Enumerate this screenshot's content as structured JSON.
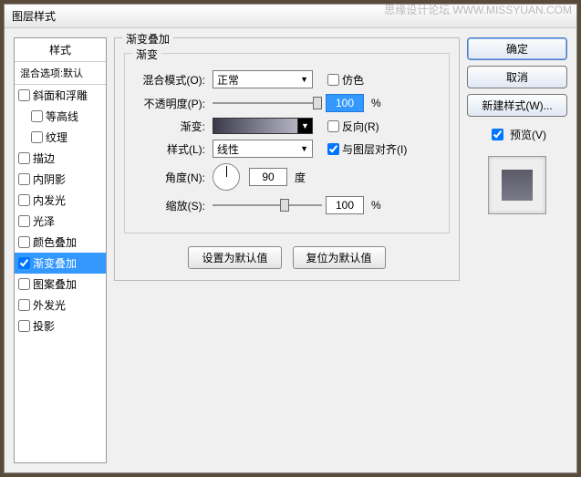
{
  "watermark": {
    "site": "思缘设计论坛",
    "url": "WWW.MISSYUAN.COM"
  },
  "dialog_title": "图层样式",
  "styles": {
    "header": "样式",
    "subheader": "混合选项:默认",
    "items": [
      {
        "label": "斜面和浮雕",
        "checked": false,
        "indent": false
      },
      {
        "label": "等高线",
        "checked": false,
        "indent": true
      },
      {
        "label": "纹理",
        "checked": false,
        "indent": true
      },
      {
        "label": "描边",
        "checked": false,
        "indent": false
      },
      {
        "label": "内阴影",
        "checked": false,
        "indent": false
      },
      {
        "label": "内发光",
        "checked": false,
        "indent": false
      },
      {
        "label": "光泽",
        "checked": false,
        "indent": false
      },
      {
        "label": "颜色叠加",
        "checked": false,
        "indent": false
      },
      {
        "label": "渐变叠加",
        "checked": true,
        "indent": false,
        "selected": true
      },
      {
        "label": "图案叠加",
        "checked": false,
        "indent": false
      },
      {
        "label": "外发光",
        "checked": false,
        "indent": false
      },
      {
        "label": "投影",
        "checked": false,
        "indent": false
      }
    ]
  },
  "center": {
    "group_title": "渐变叠加",
    "inner_title": "渐变",
    "blend_label": "混合模式(O):",
    "blend_value": "正常",
    "dither_label": "仿色",
    "opacity_label": "不透明度(P):",
    "opacity_value": "100",
    "opacity_unit": "%",
    "gradient_label": "渐变:",
    "reverse_label": "反向(R)",
    "style_label": "样式(L):",
    "style_value": "线性",
    "align_label": "与图层对齐(I)",
    "angle_label": "角度(N):",
    "angle_value": "90",
    "angle_unit": "度",
    "scale_label": "缩放(S):",
    "scale_value": "100",
    "scale_unit": "%",
    "set_default": "设置为默认值",
    "reset_default": "复位为默认值"
  },
  "right": {
    "ok": "确定",
    "cancel": "取消",
    "new_style": "新建样式(W)...",
    "preview_label": "预览(V)"
  }
}
